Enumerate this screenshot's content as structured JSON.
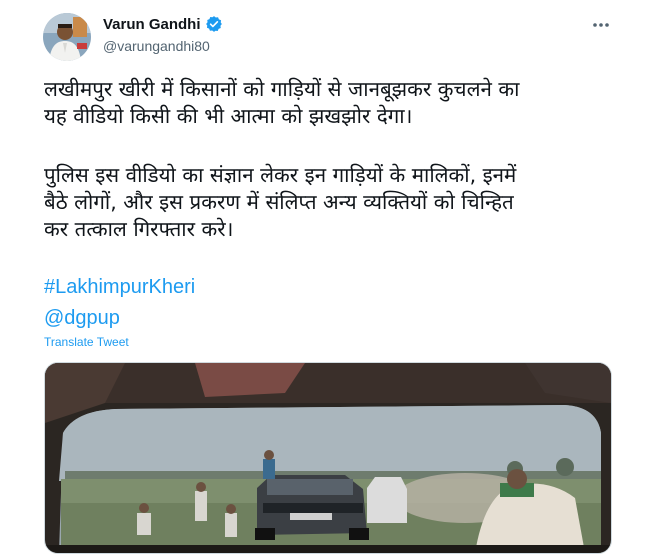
{
  "author": {
    "display_name": "Varun Gandhi",
    "handle": "@varungandhi80"
  },
  "tweet": {
    "lines_para1": [
      "लखीमपुर खीरी में किसानों को गाड़ियों से जानबूझकर कुचलने का",
      "यह वीडियो किसी की भी आत्मा को झखझोर देगा।"
    ],
    "lines_para2": [
      "पुलिस इस वीडियो का संज्ञान लेकर इन गाड़ियों के मालिकों, इनमें",
      "बैठे लोगों, और इस प्रकरण में संलिप्त अन्य व्यक्तियों को चिन्हित",
      "कर तत्काल गिरफ्तार करे।"
    ],
    "hashtag": "#LakhimpurKheri",
    "mention": "@dgpup",
    "translate_label": "Translate Tweet"
  },
  "icons": {
    "verified": "verified-badge-icon",
    "more": "more-options-icon"
  },
  "colors": {
    "link": "#1d9bf0",
    "secondary_text": "#536471",
    "verified": "#1d9bf0"
  }
}
